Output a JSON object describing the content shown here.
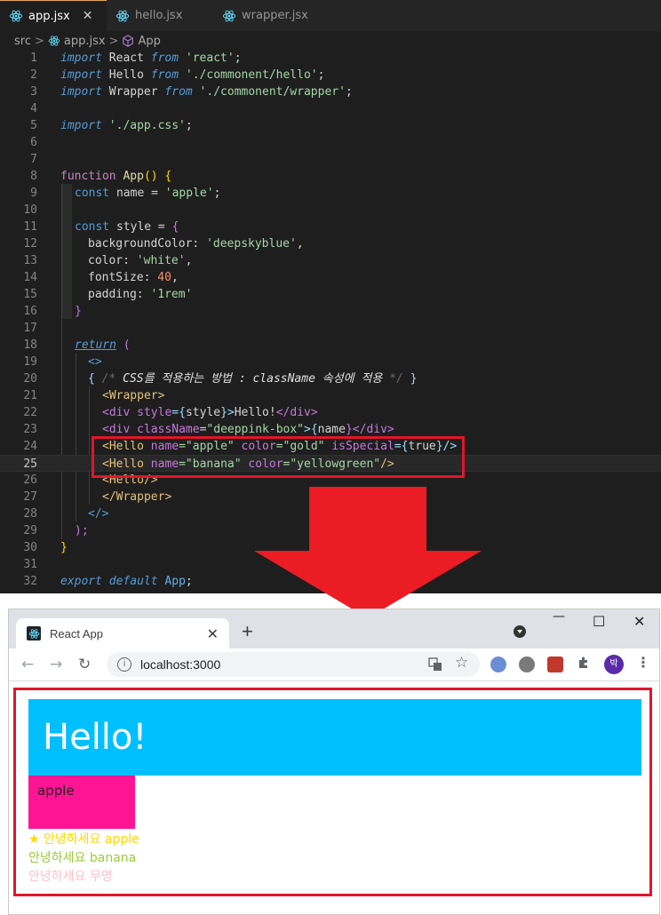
{
  "editor": {
    "tabs": [
      {
        "label": "app.jsx",
        "close": "✕",
        "active": true
      },
      {
        "label": "hello.jsx",
        "active": false
      },
      {
        "label": "wrapper.jsx",
        "active": false
      }
    ],
    "breadcrumb": {
      "folder": "src",
      "file": "app.jsx",
      "symbol": "App",
      "sep": ">"
    },
    "line_numbers": [
      "1",
      "2",
      "3",
      "4",
      "5",
      "6",
      "7",
      "8",
      "9",
      "10",
      "11",
      "12",
      "13",
      "14",
      "15",
      "16",
      "17",
      "18",
      "19",
      "20",
      "21",
      "22",
      "23",
      "24",
      "25",
      "26",
      "27",
      "28",
      "29",
      "30",
      "31",
      "32"
    ],
    "code": {
      "l1": {
        "kw": "import",
        "name": " React ",
        "from": "from",
        "str": " 'react'",
        "end": ";"
      },
      "l2": {
        "kw": "import",
        "name": " Hello ",
        "from": "from",
        "str": " './commonent/hello'",
        "end": ";"
      },
      "l3": {
        "kw": "import",
        "name": " Wrapper ",
        "from": "from",
        "str": " './commonent/wrapper'",
        "end": ";"
      },
      "l5": {
        "kw": "import",
        "str": " './app.css'",
        "end": ";"
      },
      "l8": {
        "kw": "function",
        "fn": " App",
        "paren": "()",
        "brace": " {"
      },
      "l9": {
        "kw": "const",
        "name": " name = ",
        "str": "'apple'",
        "end": ";"
      },
      "l11": {
        "kw": "const",
        "name": " style = ",
        "brace": "{"
      },
      "l12": {
        "key": "backgroundColor: ",
        "str": "'deepskyblue'",
        "end": ","
      },
      "l13": {
        "key": "color: ",
        "str": "'white'",
        "end": ","
      },
      "l14": {
        "key": "fontSize: ",
        "num": "40",
        "end": ","
      },
      "l15": {
        "key": "padding: ",
        "str": "'1rem'"
      },
      "l16": {
        "brace": "}"
      },
      "l18": {
        "kw": "return",
        "paren": " ("
      },
      "l19": {
        "tag": "<>"
      },
      "l20": {
        "open": "{ ",
        "cmt_open": "/* ",
        "cmt": "CSS를 적용하는 방법 : className 속성에 적용",
        "cmt_close": " */",
        "close": " }"
      },
      "l21": {
        "tag": "<Wrapper>"
      },
      "l22": {
        "a": "<div ",
        "attr": "style",
        "b": "={",
        "c": "style",
        "d": "}>",
        "e": "Hello!",
        "f": "</div>"
      },
      "l23": {
        "a": "<div ",
        "attr": "className",
        "b": "=",
        "s": "\"deeppink-box\"",
        "c": ">{",
        "d": "name",
        "e": "}</div>"
      },
      "l24": {
        "a": "<Hello ",
        "attr1": "name",
        "s1": "=\"apple\"",
        "attr2": " color",
        "s2": "=\"gold\"",
        "attr3": " isSpecial",
        "b": "={",
        "c": "true",
        "d": "}/>"
      },
      "l25": {
        "a": "<Hello ",
        "attr1": "name",
        "s1": "=\"banana\"",
        "attr2": " color",
        "s2": "=\"yellowgreen\"",
        "d": "/>"
      },
      "l26": {
        "tag": "<Hello/>"
      },
      "l27": {
        "tag": "</Wrapper>"
      },
      "l28": {
        "tag": "</>"
      },
      "l29": {
        "paren": ");"
      },
      "l30": {
        "brace": "}"
      },
      "l32": {
        "kw": "export",
        "kw2": " default",
        "name": " App",
        "end": ";"
      }
    }
  },
  "browser": {
    "tab_title": "React App",
    "tab_close": "✕",
    "new_tab": "+",
    "window": {
      "minimize": "—",
      "maximize": "☐",
      "close": "✕"
    },
    "nav": {
      "back": "←",
      "forward": "→",
      "reload": "↻"
    },
    "url": "localhost:3000",
    "info": "i",
    "avatar_text": "박",
    "menu": "⋮"
  },
  "page": {
    "hello": "Hello!",
    "pink_box": "apple",
    "line1": "★ 안녕하세요 apple",
    "line2": "안녕하세요 banana",
    "line3": "안녕하세요 무명",
    "colors": {
      "line1": "#ffd700",
      "line2": "#9acd32",
      "line3": "#ffc0cb",
      "highlight": "#e0162b"
    }
  }
}
